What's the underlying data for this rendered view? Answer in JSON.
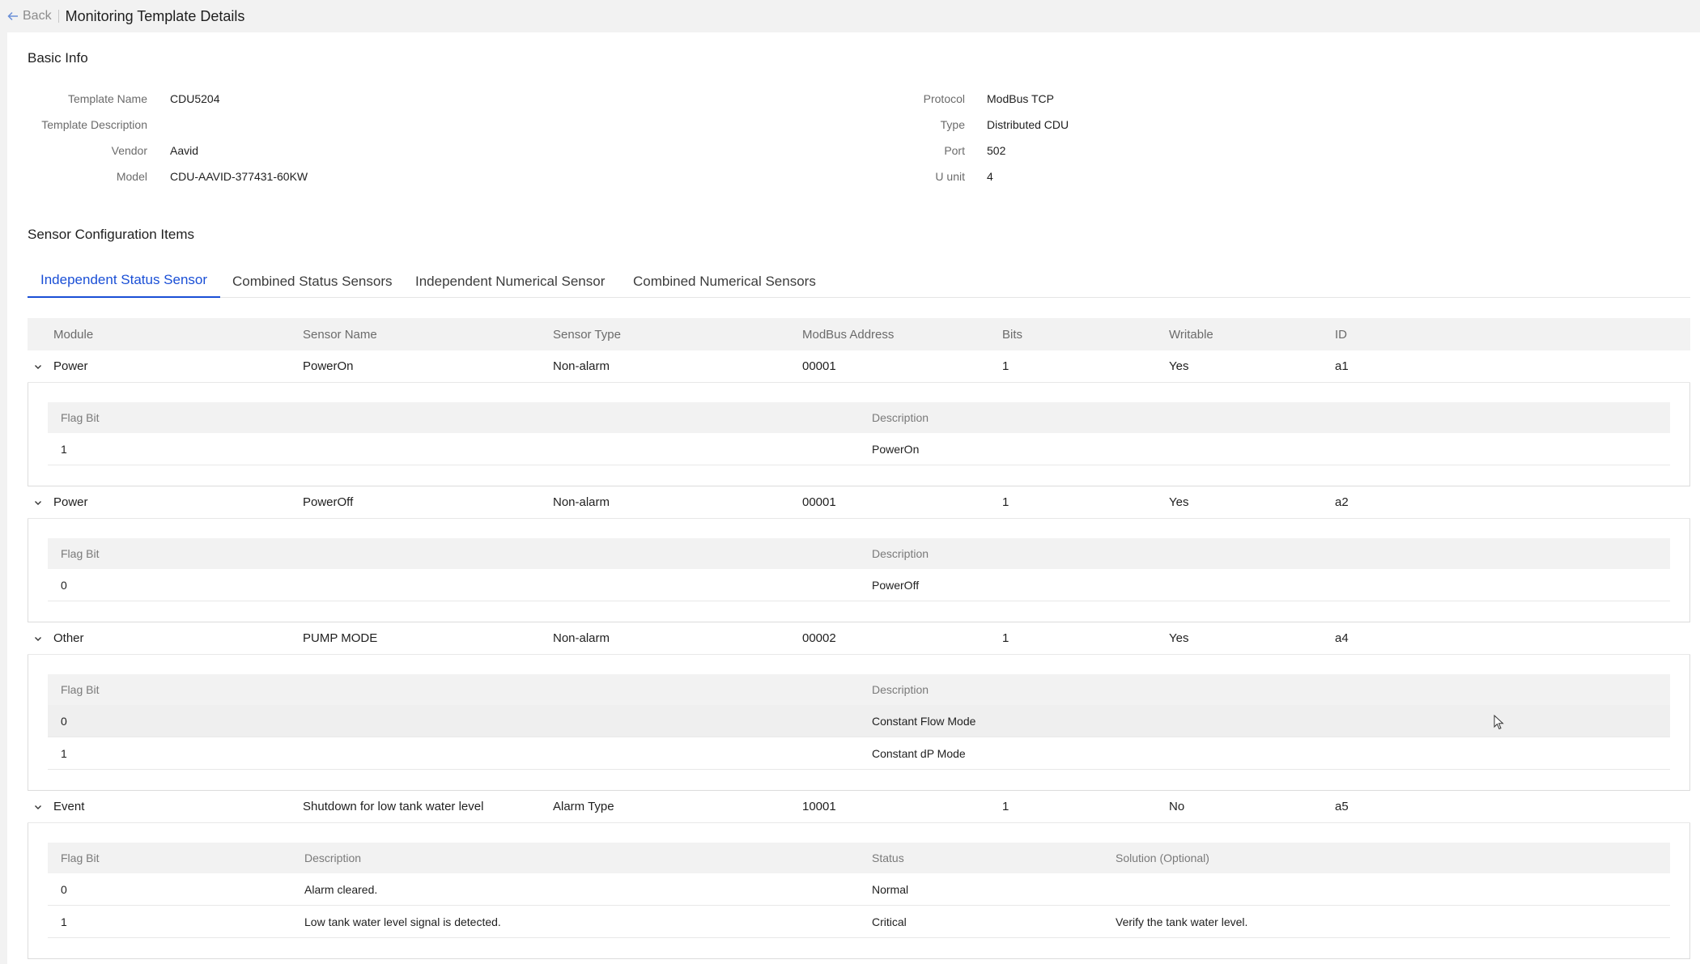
{
  "header": {
    "back_label": "Back",
    "title": "Monitoring Template Details"
  },
  "basic_info": {
    "title": "Basic Info",
    "left": [
      {
        "label": "Template Name",
        "value": "CDU5204"
      },
      {
        "label": "Template Description",
        "value": ""
      },
      {
        "label": "Vendor",
        "value": "Aavid"
      },
      {
        "label": "Model",
        "value": "CDU-AAVID-377431-60KW"
      }
    ],
    "right": [
      {
        "label": "Protocol",
        "value": "ModBus TCP"
      },
      {
        "label": "Type",
        "value": "Distributed CDU"
      },
      {
        "label": "Port",
        "value": "502"
      },
      {
        "label": "U unit",
        "value": "4"
      }
    ]
  },
  "sensor_section": {
    "title": "Sensor Configuration Items",
    "tabs": [
      {
        "label": "Independent Status Sensor",
        "active": true
      },
      {
        "label": "Combined Status Sensors"
      },
      {
        "label": "Independent Numerical Sensor"
      },
      {
        "label": "Combined Numerical Sensors"
      }
    ],
    "columns": [
      "Module",
      "Sensor Name",
      "Sensor Type",
      "ModBus Address",
      "Bits",
      "Writable",
      "ID"
    ],
    "rows": [
      {
        "module": "Power",
        "name": "PowerOn",
        "type": "Non-alarm",
        "address": "00001",
        "bits": "1",
        "writable": "Yes",
        "id": "a1",
        "sub_columns": [
          "Flag Bit",
          "Description"
        ],
        "sub_rows": [
          [
            "1",
            "PowerOn"
          ]
        ]
      },
      {
        "module": "Power",
        "name": "PowerOff",
        "type": "Non-alarm",
        "address": "00001",
        "bits": "1",
        "writable": "Yes",
        "id": "a2",
        "sub_columns": [
          "Flag Bit",
          "Description"
        ],
        "sub_rows": [
          [
            "0",
            "PowerOff"
          ]
        ]
      },
      {
        "module": "Other",
        "name": "PUMP MODE",
        "type": "Non-alarm",
        "address": "00002",
        "bits": "1",
        "writable": "Yes",
        "id": "a4",
        "sub_columns": [
          "Flag Bit",
          "Description"
        ],
        "sub_rows": [
          [
            "0",
            "Constant Flow Mode"
          ],
          [
            "1",
            "Constant dP Mode"
          ]
        ]
      },
      {
        "module": "Event",
        "name": "Shutdown for low tank water level",
        "type": "Alarm Type",
        "address": "10001",
        "bits": "1",
        "writable": "No",
        "id": "a5",
        "sub_columns": [
          "Flag Bit",
          "Description",
          "Status",
          "Solution (Optional)"
        ],
        "sub_rows": [
          [
            "0",
            "Alarm cleared.",
            "Normal",
            ""
          ],
          [
            "1",
            "Low tank water level signal is detected.",
            "Critical",
            "Verify the tank water level."
          ]
        ]
      }
    ]
  }
}
